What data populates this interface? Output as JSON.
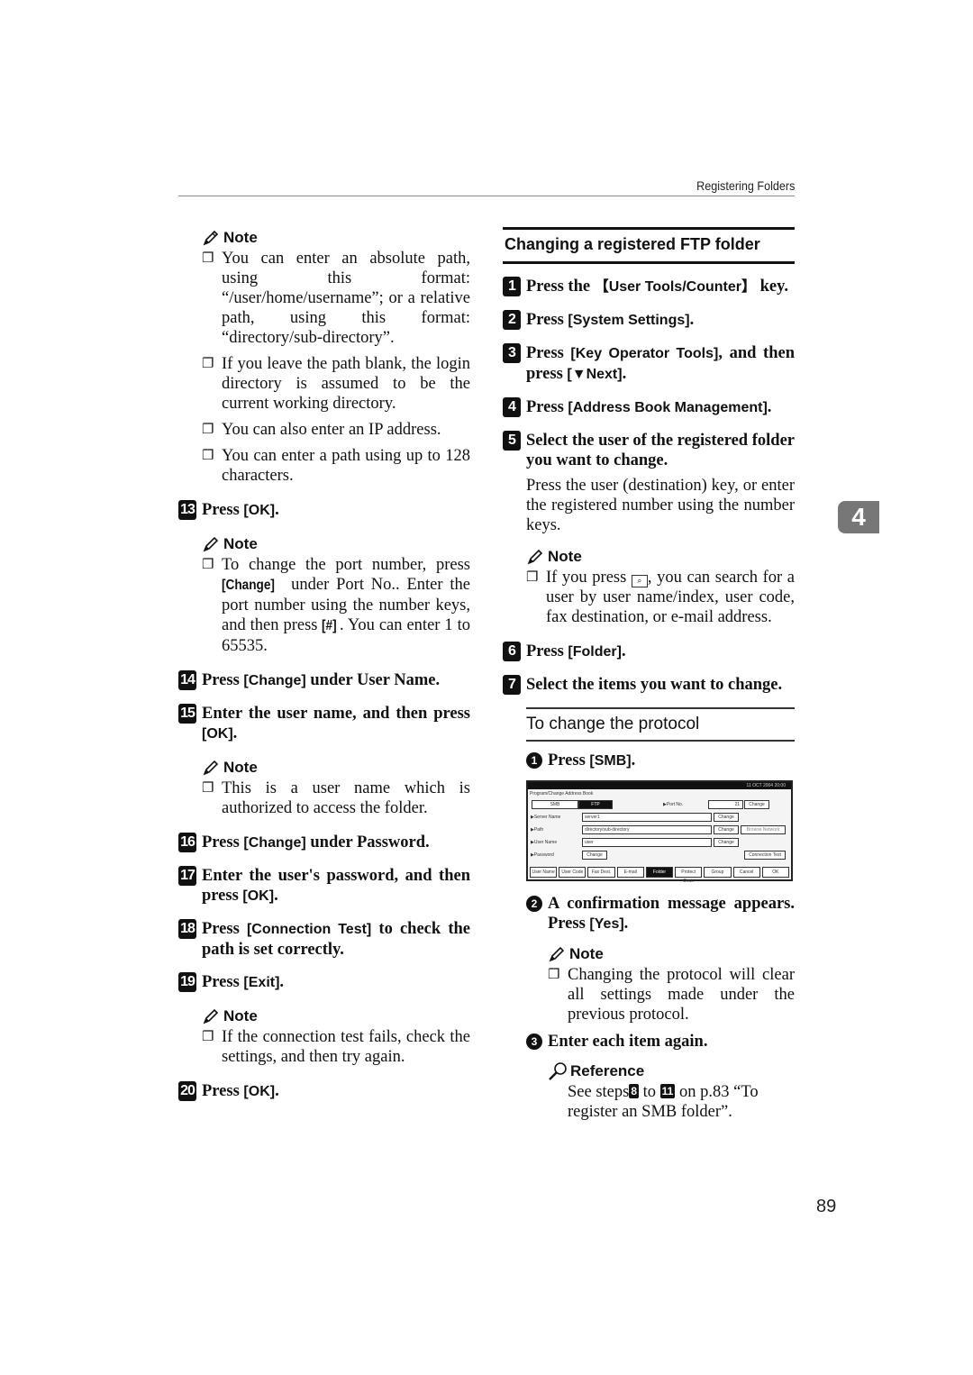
{
  "header": {
    "title": "Registering Folders"
  },
  "chapter_tab": "4",
  "page_number": "89",
  "left": {
    "note1": {
      "label": "Note",
      "items": [
        "You can enter an absolute path, using this format: “/user/home/username”; or a relative path, using this format: “directory/sub-directory”.",
        "If you leave the path blank, the login directory is assumed to be the current working directory.",
        "You can also enter an IP address.",
        "You can enter a path using up to 128 characters."
      ]
    },
    "step13": {
      "num": "13",
      "pre": "Press ",
      "key": "[OK]",
      "post": "."
    },
    "note2": {
      "label": "Note",
      "p1": "To change the port number, press ",
      "k1": "[Change]",
      "p2": " under Port No.. Enter the port number using the number keys, and then press ",
      "k2": "[#]",
      "p3": ". You can enter 1 to 65535."
    },
    "step14": {
      "num": "14",
      "pre": "Press ",
      "key": "[Change]",
      "post": " under User Name."
    },
    "step15": {
      "num": "15",
      "pre": "Enter the user name, and then press ",
      "key": "[OK]",
      "post": "."
    },
    "note3": {
      "label": "Note",
      "items": [
        "This is a user name which is authorized to access the folder."
      ]
    },
    "step16": {
      "num": "16",
      "pre": "Press ",
      "key": "[Change]",
      "post": " under Password."
    },
    "step17": {
      "num": "17",
      "pre": "Enter the user's password, and then press ",
      "key": "[OK]",
      "post": "."
    },
    "step18": {
      "num": "18",
      "pre": "Press ",
      "key": "[Connection Test]",
      "post": " to check the path is set correctly."
    },
    "step19": {
      "num": "19",
      "pre": "Press ",
      "key": "[Exit]",
      "post": "."
    },
    "note4": {
      "label": "Note",
      "items": [
        "If the connection test fails, check the settings, and then try again."
      ]
    },
    "step20": {
      "num": "20",
      "pre": "Press ",
      "key": "[OK]",
      "post": "."
    }
  },
  "right": {
    "section_title": "Changing a registered FTP folder",
    "step1": {
      "num": "1",
      "pre": "Press the ",
      "key": "【User Tools/Counter】",
      "post": " key."
    },
    "step2": {
      "num": "2",
      "pre": "Press ",
      "key": "[System Settings]",
      "post": "."
    },
    "step3": {
      "num": "3",
      "pre": "Press ",
      "key": "[Key Operator Tools]",
      "mid": ", and then press ",
      "key2": "[▼Next]",
      "post": "."
    },
    "step4": {
      "num": "4",
      "pre": "Press ",
      "key": "[Address Book Management]",
      "post": "."
    },
    "step5": {
      "num": "5",
      "text": "Select the user of the registered folder you want to change."
    },
    "step5_para": "Press the user (destination) key, or enter the registered number using the number keys.",
    "note5": {
      "label": "Note",
      "p1": "If you press ",
      "p2": ", you can search for a user by user name/index, user code, fax destination, or e-mail address."
    },
    "step6": {
      "num": "6",
      "pre": "Press ",
      "key": "[Folder]",
      "post": "."
    },
    "step7": {
      "num": "7",
      "text": "Select the items you want to change."
    },
    "subsection_title": "To change the protocol",
    "sub1": {
      "num": "1",
      "pre": "Press ",
      "key": "[SMB]",
      "post": "."
    },
    "screen": {
      "clock": "11 OCT 2004 20:00",
      "title": "Program/Change Address Book",
      "protocol_smb": "SMB",
      "protocol_ftp": "FTP",
      "port_label": "▶Port No.",
      "port_value": "21",
      "change": "Change",
      "server_label": "▶Server Name",
      "server_value": "server1",
      "path_label": "▶Path",
      "path_value": "directory/sub-directory",
      "browse": "Browse Network",
      "user_label": "▶User Name",
      "user_value": "user",
      "password_label": "▶Password",
      "connection_test": "Connection Test",
      "tabs": [
        "User Name",
        "User Code",
        "Fax Dest.",
        "E-mail",
        "Folder",
        "Protect Dest.",
        "Group"
      ],
      "cancel": "Cancel",
      "ok": "OK"
    },
    "sub2": {
      "num": "2",
      "pre": "A confirmation message appears. Press ",
      "key": "[Yes]",
      "post": "."
    },
    "note6": {
      "label": "Note",
      "items": [
        "Changing the protocol will clear all settings made under the previous protocol."
      ]
    },
    "sub3": {
      "num": "3",
      "text": "Enter each item again."
    },
    "reference": {
      "label": "Reference",
      "p1": "See steps",
      "n1": "8",
      "p2": " to ",
      "n2": "11",
      "p3": " on p.83 “To register an SMB folder”."
    }
  }
}
